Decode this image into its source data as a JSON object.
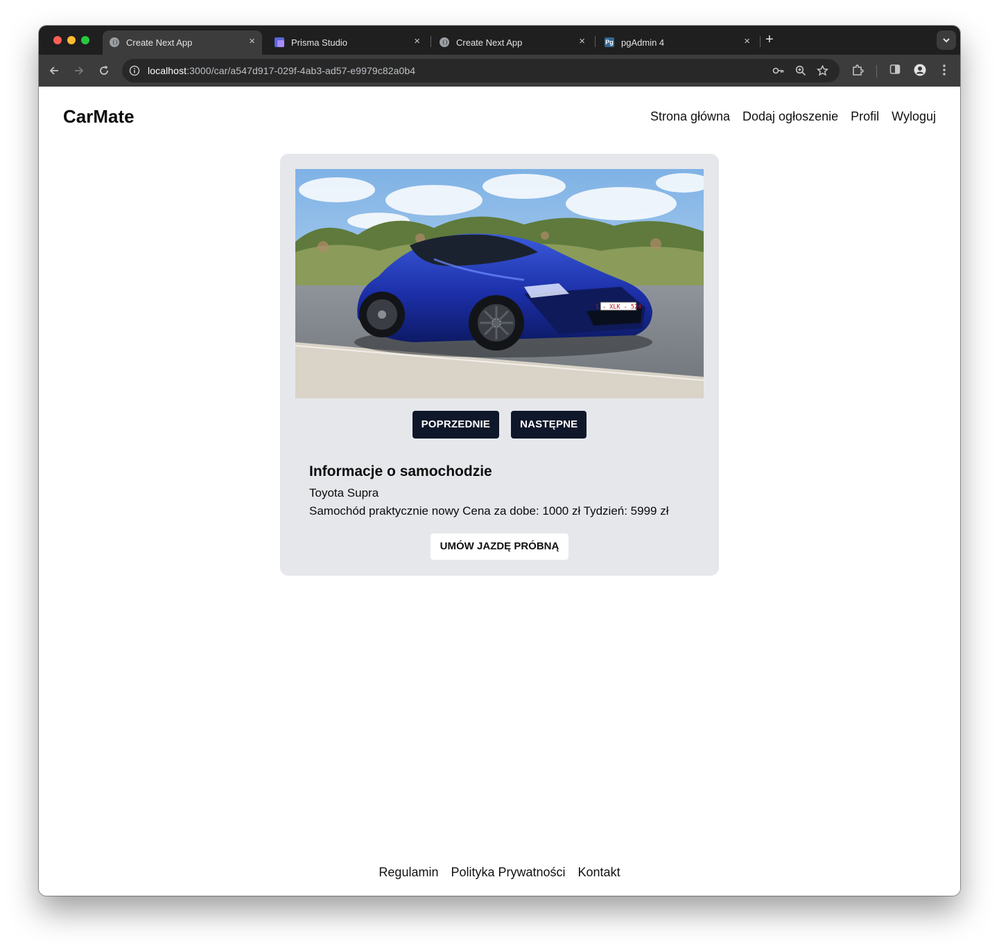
{
  "browser": {
    "tabs": [
      {
        "title": "Create Next App",
        "favicon": "globe-icon",
        "active": true
      },
      {
        "title": "Prisma Studio",
        "favicon": "prisma-icon",
        "active": false
      },
      {
        "title": "Create Next App",
        "favicon": "globe-icon",
        "active": false
      },
      {
        "title": "pgAdmin 4",
        "favicon": "pgadmin-icon",
        "active": false
      }
    ],
    "close_glyph": "×",
    "new_tab_glyph": "+",
    "pgadmin_favicon_text": "Pg",
    "url_host": "localhost",
    "url_path": ":3000/car/a547d917-029f-4ab3-ad57-e9979c82a0b4"
  },
  "header": {
    "brand": "CarMate",
    "nav": [
      "Strona główna",
      "Dodaj ogłoszenie",
      "Profil",
      "Wyloguj"
    ]
  },
  "gallery": {
    "image_alt": "Blue Toyota Supra sports car",
    "plate": "1 - XLK - 524",
    "prev_label": "POPRZEDNIE",
    "next_label": "NASTĘPNE"
  },
  "car_info": {
    "heading": "Informacje o samochodzie",
    "model": "Toyota Supra",
    "description": "Samochód praktycznie nowy Cena za dobe: 1000 zł Tydzień: 5999 zł",
    "cta_label": "UMÓW JAZDĘ PRÓBNĄ"
  },
  "footer": {
    "links": [
      "Regulamin",
      "Polityka Prywatności",
      "Kontakt"
    ]
  },
  "colors": {
    "card_bg": "#e5e7eb",
    "button_dark": "#0f172a",
    "browser_chrome": "#1f1f1f"
  }
}
